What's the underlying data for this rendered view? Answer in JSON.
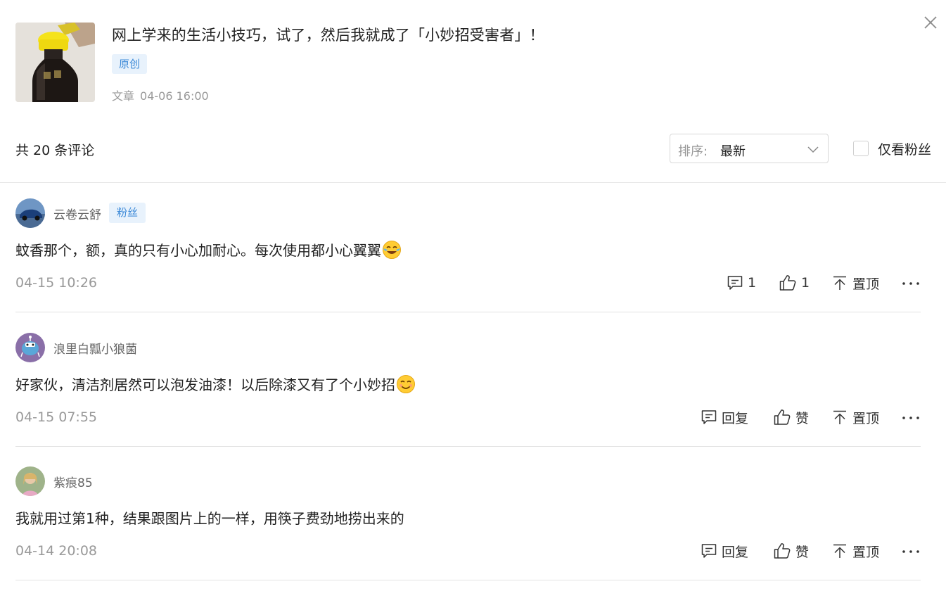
{
  "article": {
    "title": "网上学来的生活小技巧，试了，然后我就成了「小妙招受害者」！",
    "tag": "原创",
    "type": "文章",
    "time": "04-06 16:00",
    "thumbnail_icon": "soy-sauce-bottle"
  },
  "toolbar": {
    "count_label": "共 20 条评论",
    "sort_prefix": "排序:",
    "sort_value": "最新",
    "fans_only_label": "仅看粉丝",
    "fans_only_checked": false
  },
  "actions": {
    "reply_label": "回复",
    "like_label": "赞",
    "pin_label": "置顶"
  },
  "comments": [
    {
      "username": "云卷云舒",
      "badge": "粉丝",
      "text": "蚊香那个，额，真的只有小心加耐心。每次使用都小心翼翼",
      "emoji": "crying-laughing-emoji",
      "time": "04-15 10:26",
      "reply_count": "1",
      "like_count": "1"
    },
    {
      "username": "浪里白瓢小狼菌",
      "text": "好家伙，清洁剂居然可以泡发油漆！以后除漆又有了个小妙招",
      "emoji": "cheeky-smile-emoji",
      "time": "04-15 07:55"
    },
    {
      "username": "紫痕85",
      "text": "我就用过第1种，结果跟图片上的一样，用筷子费劲地捞出来的",
      "time": "04-14 20:08"
    }
  ]
}
